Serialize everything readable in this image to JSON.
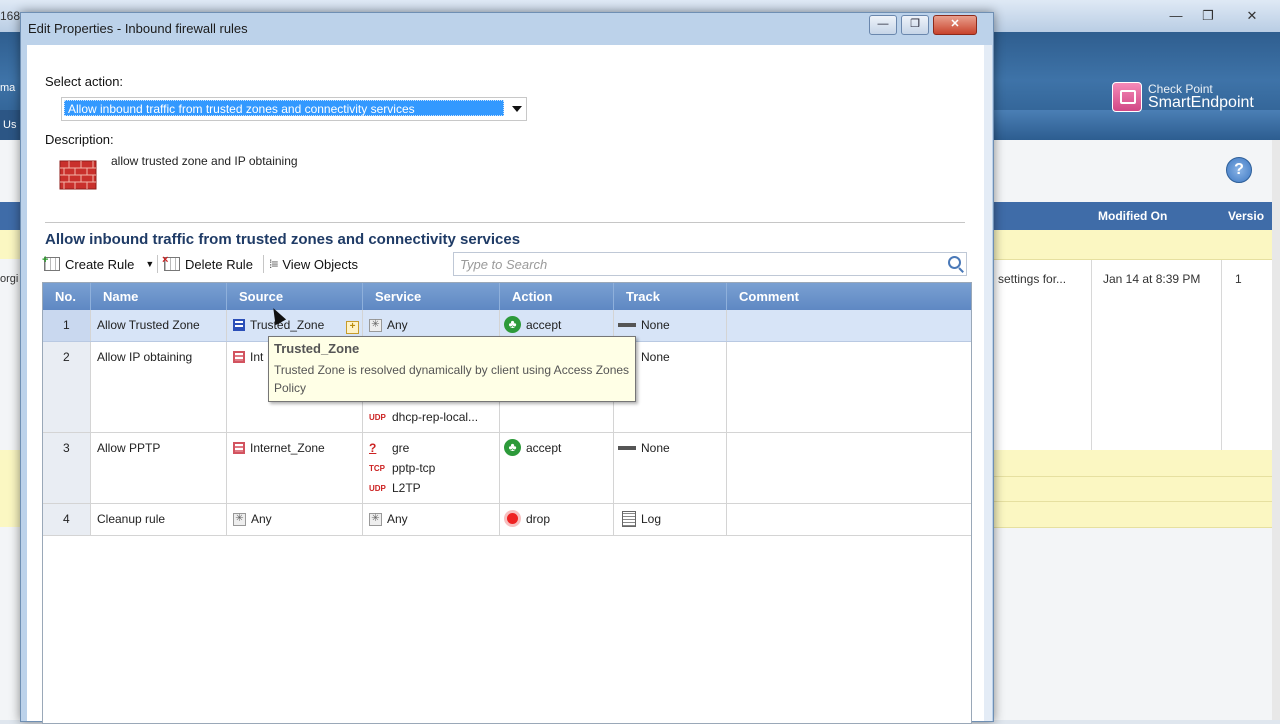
{
  "background_app": {
    "titlebar_left_fragment": "168",
    "window_buttons": [
      "—",
      "❐",
      "✕"
    ],
    "header_tab_fragment": "Us",
    "header_left_fragment": "ma",
    "logo": {
      "small": "Check Point",
      "big": "SmartEndpoint"
    },
    "help_label": "?",
    "table": {
      "headers": [
        "Modified On",
        "Versio"
      ],
      "row": {
        "description_fragment": "settings for...",
        "modified_on": "Jan 14 at 8:39 PM",
        "version": "1"
      },
      "left_fragment": "orgi"
    }
  },
  "dialog": {
    "title": "Edit Properties - Inbound firewall rules",
    "buttons": {
      "minimize": "—",
      "maximize": "❐",
      "close": "✕"
    },
    "select_action_label": "Select action:",
    "selected_action": "Allow inbound traffic from trusted zones and connectivity services",
    "description_label": "Description:",
    "description_text": "allow trusted zone and IP obtaining",
    "section_title": "Allow inbound traffic from trusted zones and connectivity services",
    "toolbar": {
      "create_rule": "Create Rule",
      "delete_rule": "Delete Rule",
      "view_objects": "View Objects",
      "search_placeholder": "Type to Search"
    },
    "columns": [
      "No.",
      "Name",
      "Source",
      "Service",
      "Action",
      "Track",
      "Comment"
    ],
    "rules": [
      {
        "no": "1",
        "name": "Allow Trusted Zone",
        "source": "Trusted_Zone",
        "service": "Any",
        "action": "accept",
        "track": "None",
        "comment": ""
      },
      {
        "no": "2",
        "name": "Allow IP obtaining",
        "source": "Int",
        "service_last": "dhcp-rep-local...",
        "track": "None",
        "comment": ""
      },
      {
        "no": "3",
        "name": "Allow PPTP",
        "source": "Internet_Zone",
        "services": [
          {
            "proto": "?",
            "name": "gre"
          },
          {
            "proto": "TCP",
            "name": "pptp-tcp"
          },
          {
            "proto": "UDP",
            "name": "L2TP"
          }
        ],
        "action": "accept",
        "track": "None",
        "comment": ""
      },
      {
        "no": "4",
        "name": "Cleanup rule",
        "source": "Any",
        "service": "Any",
        "action": "drop",
        "track": "Log",
        "comment": ""
      }
    ],
    "tooltip": {
      "title": "Trusted_Zone",
      "text": "Trusted Zone is resolved dynamically by client using Access Zones  Policy"
    }
  }
}
